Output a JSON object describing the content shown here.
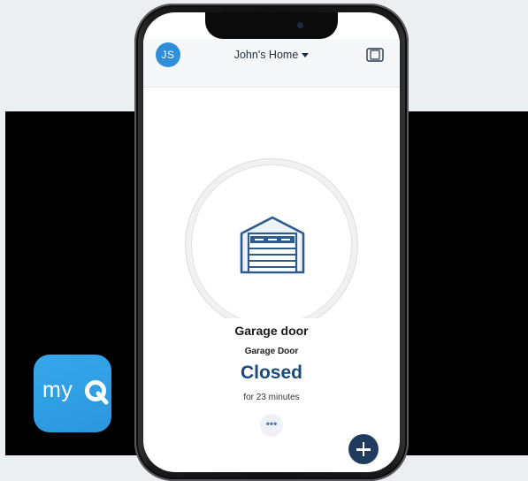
{
  "header": {
    "avatar_initials": "JS",
    "home_name": "John's Home",
    "dropdown_icon": "caret-down-icon",
    "switch_icon": "device-switch-icon"
  },
  "device": {
    "name": "Garage door",
    "type": "Garage Door",
    "state": "Closed",
    "duration": "for 23 minutes",
    "icon": "garage-door-icon"
  },
  "actions": {
    "more_label": "•••",
    "add_icon": "plus-icon"
  },
  "app_logo": {
    "text_my": "my",
    "text_q": "Q"
  },
  "colors": {
    "accent_blue": "#2f8ed8",
    "state_blue": "#1b4a78",
    "fab_navy": "#1f3c5e",
    "logo_blue": "#2b96dd"
  }
}
